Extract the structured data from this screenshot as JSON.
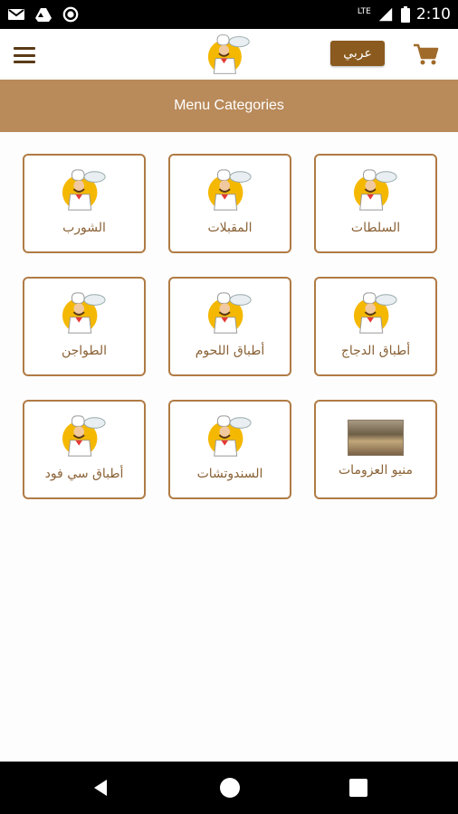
{
  "status_bar": {
    "time": "2:10",
    "network": "LTE",
    "icons": [
      "gmail-icon",
      "drive-icon",
      "record-icon",
      "signal-icon",
      "battery-icon"
    ]
  },
  "app_bar": {
    "language_button": "عربي",
    "icons": [
      "menu-icon",
      "chef-logo-icon",
      "cart-icon"
    ]
  },
  "header": {
    "title": "Menu Categories"
  },
  "categories": [
    {
      "label": "الشورب",
      "image": "chef-icon"
    },
    {
      "label": "المقبلات",
      "image": "chef-icon"
    },
    {
      "label": "السلطات",
      "image": "chef-icon"
    },
    {
      "label": "الطواجن",
      "image": "chef-icon"
    },
    {
      "label": "أطباق اللحوم",
      "image": "chef-icon"
    },
    {
      "label": "أطباق الدجاج",
      "image": "chef-icon"
    },
    {
      "label": "أطباق سي فود",
      "image": "chef-icon"
    },
    {
      "label": "السندوتشات",
      "image": "chef-icon"
    },
    {
      "label": "منيو العزومات",
      "image": "buffet-photo"
    }
  ],
  "colors": {
    "header_bg": "#b98a5a",
    "card_border": "#b07b45",
    "label_text": "#8a6236",
    "lang_button_bg": "#8a5a1f"
  }
}
